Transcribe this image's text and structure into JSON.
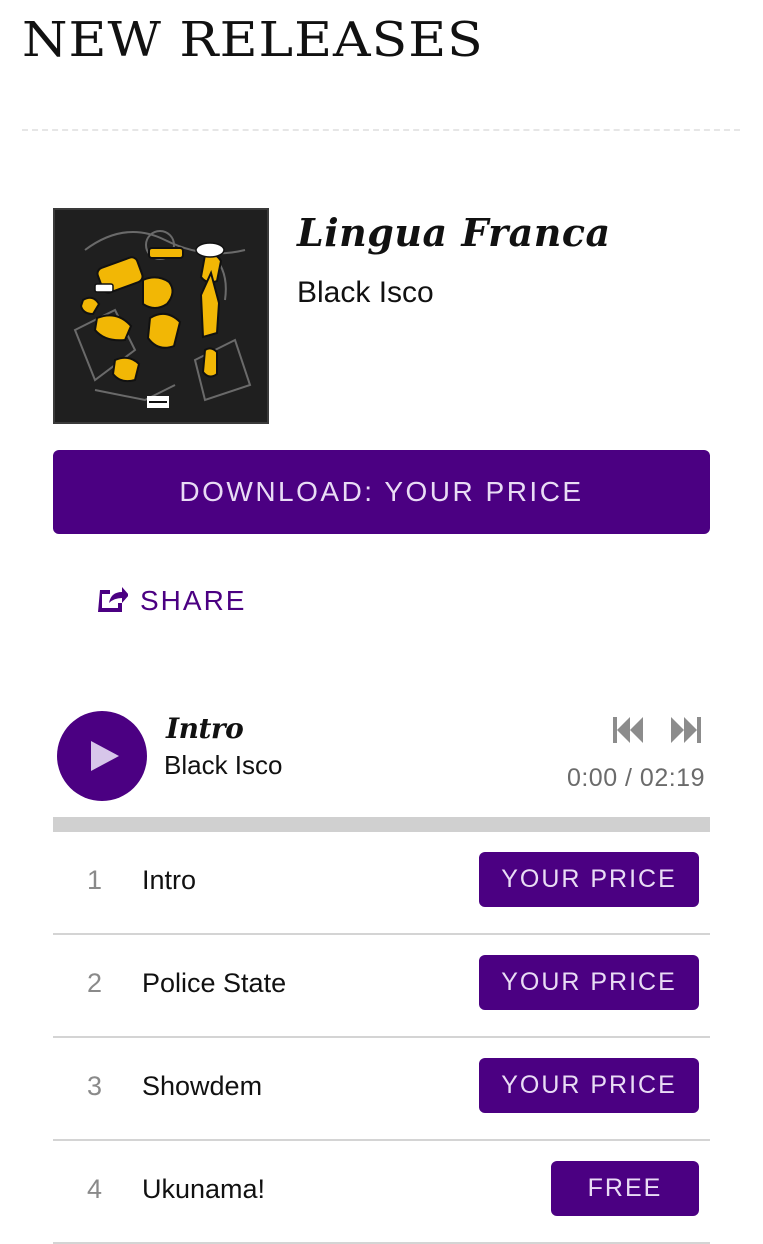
{
  "page": {
    "heading": "NEW RELEASES"
  },
  "album": {
    "title": "Lingua Franca",
    "artist": "Black Isco",
    "art_label": "PARENTAL ADVISORY EXPLICIT CONTENT"
  },
  "actions": {
    "download_label": "DOWNLOAD: YOUR PRICE",
    "share_label": "SHARE"
  },
  "player": {
    "track_title": "Intro",
    "track_artist": "Black Isco",
    "time": "0:00 / 02:19",
    "progress": 0
  },
  "tracks": [
    {
      "number": "1",
      "title": "Intro",
      "price": "YOUR PRICE"
    },
    {
      "number": "2",
      "title": "Police State",
      "price": "YOUR PRICE"
    },
    {
      "number": "3",
      "title": "Showdem",
      "price": "YOUR PRICE"
    },
    {
      "number": "4",
      "title": "Ukunama!",
      "price": "FREE"
    }
  ],
  "colors": {
    "accent": "#4b0082",
    "button_text": "#e9dcf5",
    "art_yellow": "#f2b705",
    "divider": "#d4d4d4"
  },
  "icons": {
    "share": "share-icon",
    "play": "play-icon",
    "previous": "skip-previous-icon",
    "next": "skip-next-icon"
  }
}
